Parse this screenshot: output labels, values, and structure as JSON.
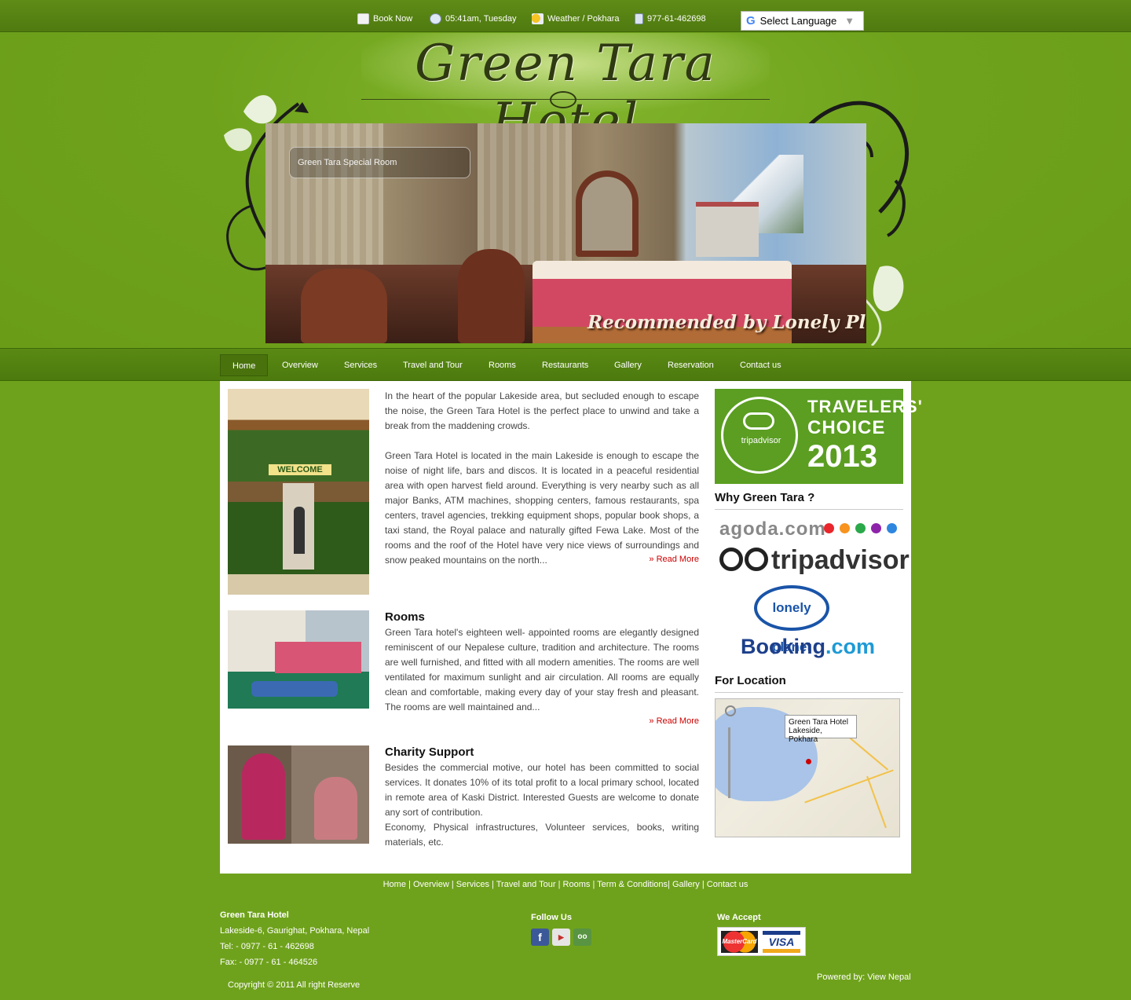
{
  "topbar": {
    "book_now": "Book Now",
    "datetime": "05:41am, Tuesday",
    "weather": "Weather / Pokhara",
    "phone": "977-61-462698",
    "language": "Select Language",
    "language_caret": "▼",
    "google_g": "G"
  },
  "header": {
    "logo": "Green Tara Hotel",
    "slide_caption": "Green Tara Special Room",
    "slide_tagline": "Recommended by Lonely Planet."
  },
  "nav": {
    "items": [
      "Home",
      "Overview",
      "Services",
      "Travel and Tour",
      "Rooms",
      "Restaurants",
      "Gallery",
      "Reservation",
      "Contact us"
    ],
    "active": "Home"
  },
  "main": {
    "intro_p1": "In the heart of the popular Lakeside area, but secluded enough to escape the noise, the Green Tara Hotel is the perfect place to unwind and take a break from the maddening crowds.",
    "intro_p2": "Green Tara Hotel is located in the main Lakeside is enough to escape the noise of night life, bars and discos. It is located in a peaceful residential area with open harvest field around. Everything is very nearby such as all major Banks, ATM machines, shopping centers, famous restaurants, spa centers, travel agencies, trekking equipment shops, popular book shops, a taxi stand, the Royal palace and naturally gifted Fewa Lake. Most of the rooms and the roof of the Hotel have very nice views of surroundings and snow peaked mountains on the north...",
    "read_more": "» Read More",
    "welcome_sign": "WELCOME",
    "rooms_title": "Rooms",
    "rooms_text": "Green Tara hotel's eighteen well- appointed rooms are elegantly designed reminiscent of our Nepalese culture, tradition and architecture. The rooms are well furnished, and fitted with all modern amenities. The rooms are well ventilated for maximum sunlight and air circulation. All rooms are equally clean and comfortable, making every day of your stay fresh and pleasant. The rooms are well maintained and...",
    "charity_title": "Charity Support",
    "charity_p1": "Besides the commercial motive, our hotel has been committed to social services. It donates 10% of its total profit to a local primary school, located in remote area of Kaski District. Interested Guests are welcome to donate any sort of contribution.",
    "charity_p2": "Economy, Physical infrastructures, Volunteer services, books, writing materials, etc."
  },
  "sidebar": {
    "award_logo": "tripadvisor",
    "award_line1": "TRAVELERS'",
    "award_line2": "CHOICE",
    "award_year": "2013",
    "why_title": "Why Green Tara ?",
    "agoda": "agoda.com",
    "tripadvisor": "tripadvisor",
    "lonely_planet": "lonely planet",
    "booking_a": "Booking",
    "booking_b": ".com",
    "location_title": "For Location",
    "map_title": "Green Tara Hotel",
    "map_subtitle": "Lakeside, Pokhara"
  },
  "footer": {
    "links": [
      "Home",
      "Overview",
      "Services",
      "Travel and Tour",
      "Rooms",
      "Term & Conditions",
      "Gallery",
      "Contact us"
    ],
    "hotel_name": "Green Tara Hotel",
    "address": "Lakeside-6, Gaurighat, Pokhara, Nepal",
    "tel": "Tel: - 0977 - 61 - 462698",
    "fax": "Fax: - 0977 - 61 - 464526",
    "copyright": "Copyright © 2011 All right Reserve",
    "follow_us": "Follow Us",
    "we_accept": "We Accept",
    "mastercard": "MasterCard",
    "visa": "VISA",
    "powered_by": "Powered by: View Nepal"
  },
  "colors": {
    "page_green": "#6fa21c",
    "nav_green": "#4c7a0e",
    "read_more_red": "#cc0000"
  }
}
